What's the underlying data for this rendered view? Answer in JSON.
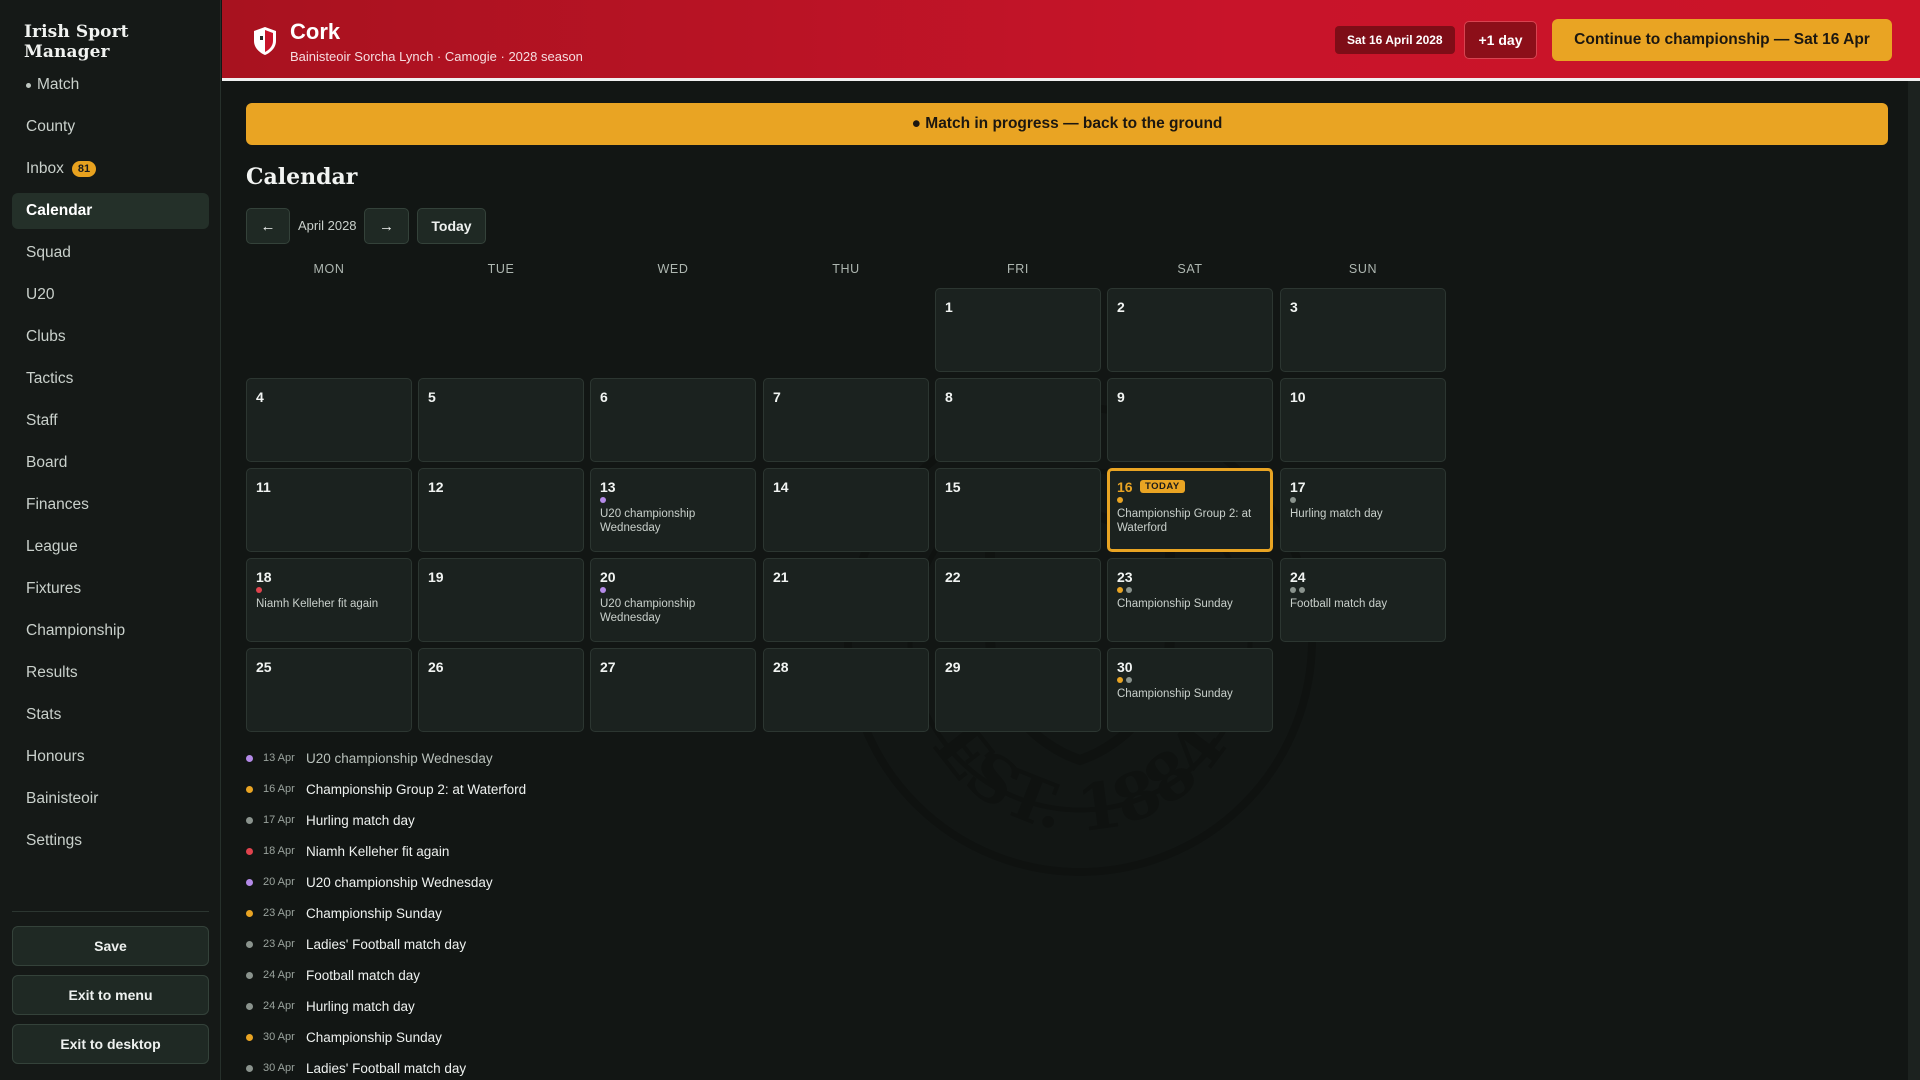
{
  "app": {
    "title": "Irish Sport Manager"
  },
  "colors": {
    "accent": "#e9a423",
    "header_red": "#c8142a",
    "dot_amber": "#e9a423",
    "dot_purple": "#b48ae8",
    "dot_red": "#e0434d",
    "dot_grey": "#8a938d"
  },
  "sidebar": {
    "items": [
      {
        "label": "Match",
        "live": true
      },
      {
        "label": "County"
      },
      {
        "label": "Inbox",
        "badge": "81"
      },
      {
        "label": "Calendar",
        "active": true
      },
      {
        "label": "Squad"
      },
      {
        "label": "U20"
      },
      {
        "label": "Clubs"
      },
      {
        "label": "Tactics"
      },
      {
        "label": "Staff"
      },
      {
        "label": "Board"
      },
      {
        "label": "Finances"
      },
      {
        "label": "League"
      },
      {
        "label": "Fixtures"
      },
      {
        "label": "Championship"
      },
      {
        "label": "Results"
      },
      {
        "label": "Stats"
      },
      {
        "label": "Honours"
      },
      {
        "label": "Bainisteoir"
      },
      {
        "label": "Settings"
      }
    ],
    "save_label": "Save",
    "exit_menu_label": "Exit to menu",
    "exit_desktop_label": "Exit to desktop"
  },
  "header": {
    "team": "Cork",
    "subtitle": "Bainisteoir Sorcha Lynch · Camogie · 2028 season",
    "date": "Sat 16 April 2028",
    "advance_label": "+1 day",
    "continue_label": "Continue to championship — Sat 16 Apr"
  },
  "banner": {
    "text": "● Match in progress — back to the ground"
  },
  "calendar": {
    "title": "Calendar",
    "prev_icon": "←",
    "next_icon": "→",
    "month": "April 2028",
    "today_label": "Today",
    "today_tag": "TODAY",
    "weekdays": [
      "MON",
      "TUE",
      "WED",
      "THU",
      "FRI",
      "SAT",
      "SUN"
    ],
    "first_weekday_index": 4,
    "days_in_month": 30,
    "today": 16,
    "events_by_day": {
      "13": {
        "dots": [
          "purple"
        ],
        "label": "U20 championship Wednesday"
      },
      "16": {
        "dots": [
          "amber"
        ],
        "label": "Championship Group 2: at Waterford"
      },
      "17": {
        "dots": [
          "grey"
        ],
        "label": "Hurling match day"
      },
      "18": {
        "dots": [
          "red"
        ],
        "label": "Niamh Kelleher fit again"
      },
      "20": {
        "dots": [
          "purple"
        ],
        "label": "U20 championship Wednesday"
      },
      "23": {
        "dots": [
          "amber",
          "grey"
        ],
        "label": "Championship Sunday"
      },
      "24": {
        "dots": [
          "grey",
          "grey"
        ],
        "label": "Football match day"
      },
      "30": {
        "dots": [
          "amber",
          "grey"
        ],
        "label": "Championship Sunday"
      }
    }
  },
  "agenda": [
    {
      "date": "13 Apr",
      "title": "U20 championship Wednesday",
      "color": "purple",
      "muted": true
    },
    {
      "date": "16 Apr",
      "title": "Championship Group 2: at Waterford",
      "color": "amber"
    },
    {
      "date": "17 Apr",
      "title": "Hurling match day",
      "color": "grey"
    },
    {
      "date": "18 Apr",
      "title": "Niamh Kelleher fit again",
      "color": "red"
    },
    {
      "date": "20 Apr",
      "title": "U20 championship Wednesday",
      "color": "purple"
    },
    {
      "date": "23 Apr",
      "title": "Championship Sunday",
      "color": "amber"
    },
    {
      "date": "23 Apr",
      "title": "Ladies' Football match day",
      "color": "grey"
    },
    {
      "date": "24 Apr",
      "title": "Football match day",
      "color": "grey"
    },
    {
      "date": "24 Apr",
      "title": "Hurling match day",
      "color": "grey"
    },
    {
      "date": "30 Apr",
      "title": "Championship Sunday",
      "color": "amber"
    },
    {
      "date": "30 Apr",
      "title": "Ladies' Football match day",
      "color": "grey"
    }
  ],
  "watermark": {
    "text": "EST. 1884"
  }
}
